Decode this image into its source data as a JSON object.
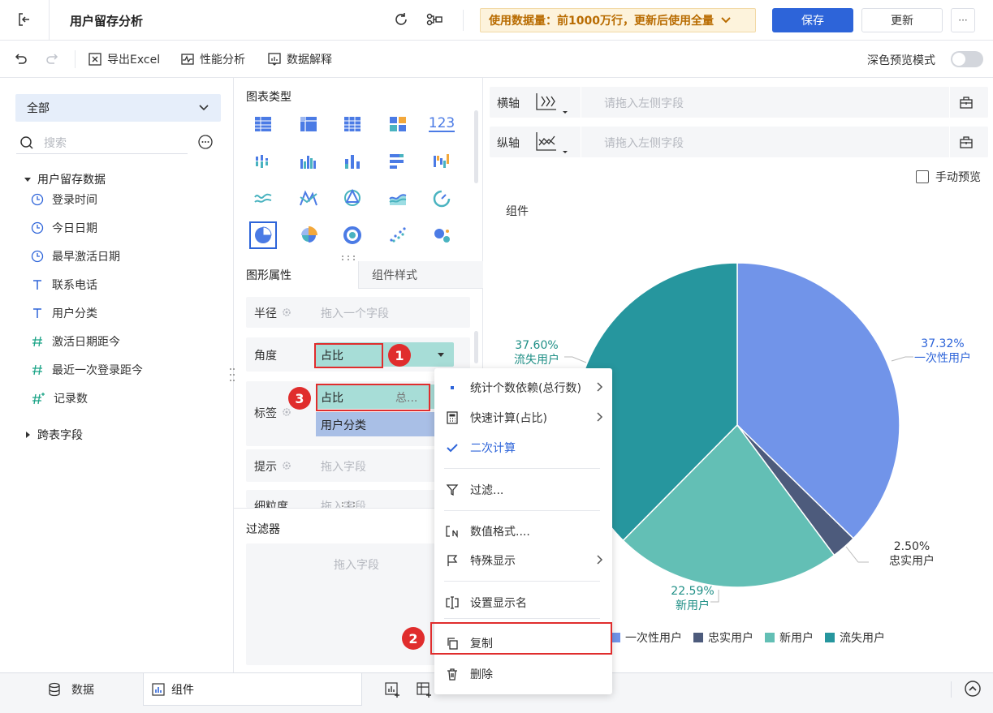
{
  "header": {
    "title": "用户留存分析",
    "notice": "使用数据量：前1000万行，更新后使用全量",
    "save_label": "保存",
    "update_label": "更新",
    "more_label": "···"
  },
  "toolbar": {
    "export_label": "导出Excel",
    "perf_label": "性能分析",
    "explain_label": "数据解释",
    "dark_preview_label": "深色预览模式"
  },
  "sidebar": {
    "scope_select": "全部",
    "search_placeholder": "搜索",
    "group_label": "用户留存数据",
    "fields": [
      {
        "type": "date",
        "label": "登录时间"
      },
      {
        "type": "date",
        "label": "今日日期"
      },
      {
        "type": "date",
        "label": "最早激活日期"
      },
      {
        "type": "text",
        "label": "联系电话"
      },
      {
        "type": "text",
        "label": "用户分类"
      },
      {
        "type": "number",
        "label": "激活日期距今"
      },
      {
        "type": "number",
        "label": "最近一次登录距今"
      },
      {
        "type": "number-calc",
        "label": "记录数"
      }
    ],
    "cross_table_label": "跨表字段"
  },
  "config": {
    "chart_type_title": "图表类型",
    "text_icon": "123",
    "tab_graph_props": "图形属性",
    "tab_component_style": "组件样式",
    "radius_label": "半径",
    "radius_placeholder": "拖入一个字段",
    "angle_label": "角度",
    "angle_value": "占比",
    "label_label": "标签",
    "label_chip1": "占比",
    "label_chip1_suffix": "总...",
    "label_chip2": "用户分类",
    "tooltip_label": "提示",
    "tooltip_placeholder": "拖入字段",
    "granularity_label": "细粒度",
    "granularity_placeholder": "拖入字段",
    "filter_title": "过滤器",
    "filter_placeholder": "拖入字段"
  },
  "context_menu": {
    "items": [
      {
        "label": "统计个数依赖(总行数)"
      },
      {
        "label": "快速计算(占比)"
      },
      {
        "label": "二次计算"
      },
      {
        "label": "过滤..."
      },
      {
        "label": "数值格式...."
      },
      {
        "label": "特殊显示"
      },
      {
        "label": "设置显示名"
      },
      {
        "label": "复制"
      },
      {
        "label": "删除"
      }
    ]
  },
  "callouts": [
    "1",
    "2",
    "3"
  ],
  "canvas": {
    "x_axis_label": "横轴",
    "x_axis_placeholder": "请拖入左侧字段",
    "y_axis_label": "纵轴",
    "y_axis_placeholder": "请拖入左侧字段",
    "manual_preview_label": "手动预览",
    "component_title": "组件"
  },
  "chart_data": {
    "type": "pie",
    "title": "",
    "slices": [
      {
        "name": "一次性用户",
        "value": 37.32,
        "label": "37.32%",
        "color": "#7194e9"
      },
      {
        "name": "忠实用户",
        "value": 2.5,
        "label": "2.50%",
        "color": "#4d5b7c"
      },
      {
        "name": "新用户",
        "value": 22.59,
        "label": "22.59%",
        "color": "#63bfb5"
      },
      {
        "name": "流失用户",
        "value": 37.6,
        "label": "37.60%",
        "color": "#26969e"
      }
    ],
    "legend_position": "bottom"
  },
  "bottom_bar": {
    "data_tab": "数据",
    "component_tab": "组件"
  },
  "colors": {
    "primary": "#2d64d9",
    "notice_bg": "#fdf3dc",
    "notice_text": "#b86b00",
    "chip_teal": "#a7ddd7",
    "chip_blue": "#a9bfe6",
    "callout_red": "#e02d2d"
  }
}
